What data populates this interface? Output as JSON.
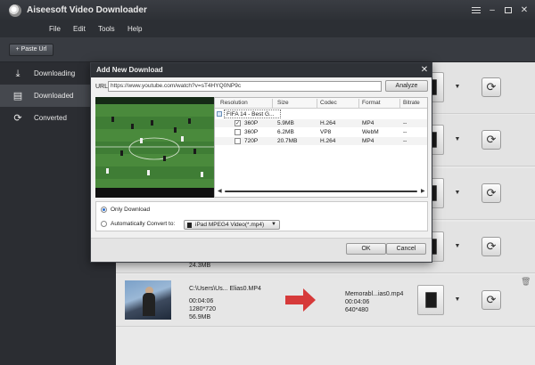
{
  "app": {
    "title": "Aiseesoft Video Downloader"
  },
  "menu": [
    "File",
    "Edit",
    "Tools",
    "Help"
  ],
  "toolbar": {
    "paste_url": "+ Paste Url"
  },
  "sidebar": {
    "items": [
      {
        "label": "Downloading",
        "icon": "download-icon"
      },
      {
        "label": "Downloaded",
        "icon": "downloaded-list-icon",
        "selected": true
      },
      {
        "label": "Converted",
        "icon": "convert-icon"
      }
    ]
  },
  "dialog": {
    "title": "Add New Download",
    "url_label": "URL:",
    "url_value": "https://www.youtube.com/watch?v=sT4HYQ0NP9c",
    "analyze_label": "Analyze",
    "columns": [
      "Resolution",
      "Size",
      "Codec",
      "Format",
      "Bitrate"
    ],
    "group_name": "FIFA 14 - Best G...",
    "rows": [
      {
        "checked": true,
        "resolution": "360P",
        "size": "5.9MB",
        "codec": "H.264",
        "format": "MP4",
        "bitrate": "--"
      },
      {
        "checked": false,
        "resolution": "360P",
        "size": "6.2MB",
        "codec": "VP8",
        "format": "WebM",
        "bitrate": "--"
      },
      {
        "checked": false,
        "resolution": "720P",
        "size": "20.7MB",
        "codec": "H.264",
        "format": "MP4",
        "bitrate": "--"
      }
    ],
    "option_only": "Only Download",
    "option_convert": "Automatically Convert to:",
    "convert_profile": "iPad MPEG4 Video(*.mp4)",
    "ok_label": "OK",
    "cancel_label": "Cancel"
  },
  "list": {
    "row4": {
      "size": "24.3MB"
    },
    "row5": {
      "source_path": "C:\\Users\\Us... Elias0.MP4",
      "source_duration": "00:04:06",
      "source_resolution": "1280*720",
      "source_size": "56.9MB",
      "output_name": "Memorabl...ias0.mp4",
      "output_duration": "00:04:06",
      "output_resolution": "640*480"
    }
  },
  "colors": {
    "accent_arrow": "#d63a3a",
    "selected_sidebar": "#45484e",
    "radio_on": "#2a6dd0"
  }
}
